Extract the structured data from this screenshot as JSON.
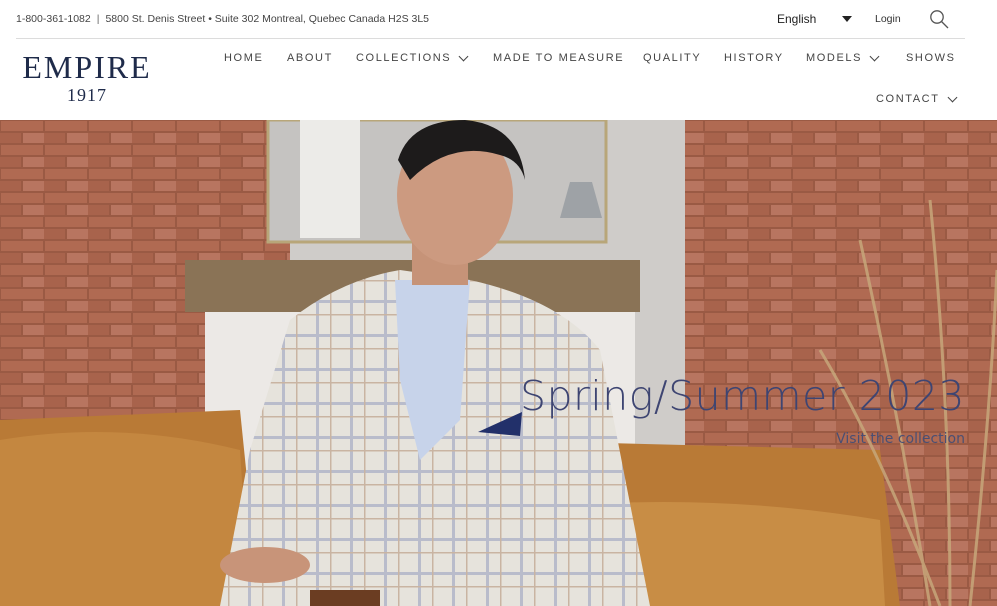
{
  "topbar": {
    "phone": "1-800-361-1082",
    "separator": "|",
    "address": "5800 St. Denis Street • Suite 302 Montreal, Quebec  Canada H2S 3L5",
    "language": "English",
    "login": "Login"
  },
  "logo": {
    "name": "EMPIRE",
    "year": "1917"
  },
  "nav": {
    "home": "HOME",
    "about": "ABOUT",
    "collections": "COLLECTIONS",
    "made_to_measure": "MADE TO MEASURE",
    "quality": "QUALITY",
    "history": "HISTORY",
    "models": "MODELS",
    "shows": "SHOWS",
    "contact": "CONTACT"
  },
  "hero": {
    "title": "Spring/Summer 2023",
    "link": "Visit the collection"
  },
  "colors": {
    "brand_navy": "#1f2b4a",
    "hero_text": "#3e4572"
  },
  "icons": [
    "search-icon",
    "caret-down-icon",
    "chevron-down-icon"
  ]
}
